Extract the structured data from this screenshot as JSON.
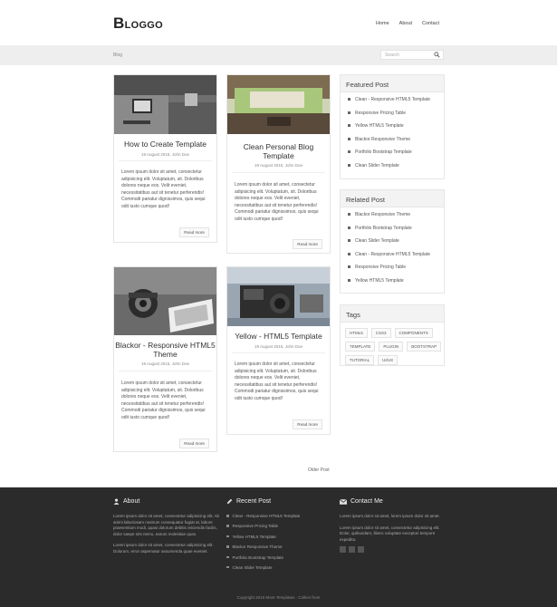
{
  "header": {
    "logo_big": "B",
    "logo_rest": "LOGGO",
    "nav": [
      "Home",
      "About",
      "Contact"
    ]
  },
  "subbar": {
    "breadcrumb": "Blog",
    "search_placeholder": "Search"
  },
  "posts": [
    {
      "title": "How to Create Template",
      "meta": "19 August 2015, John Doe",
      "excerpt": "Lorem ipsum dolor sit amet, consectetur adipisicing elit. Voluptatum, sit. Doloribus dolores neque eos. Velit eveniet, necessitatibus aut sit tenetur perferendis! Commodi pariatur dignissimos, quis sequi odit iusto cumque quod!",
      "more": "Read more"
    },
    {
      "title": "Clean Personal Blog Template",
      "meta": "19 August 2015, John Doe",
      "excerpt": "Lorem ipsum dolor sit amet, consectetur adipisicing elit. Voluptatum, sit. Doloribus dolores neque eos. Velit eveniet, necessitatibus aut sit tenetur perferendis! Commodi pariatur dignissimos, quis sequi odit iusto cumque quod!",
      "more": "Read more"
    },
    {
      "title": "Blackor - Responsive HTML5 Theme",
      "meta": "19 August 2015, John Doe",
      "excerpt": "Lorem ipsum dolor sit amet, consectetur adipisicing elit. Voluptatum, sit. Doloribus dolores neque eos. Velit eveniet, necessitatibus aut sit tenetur perferendis! Commodi pariatur dignissimos, quis sequi odit iusto cumque quod!",
      "more": "Read more"
    },
    {
      "title": "Yellow - HTML5 Template",
      "meta": "19 August 2015, John Doe",
      "excerpt": "Lorem ipsum dolor sit amet, consectetur adipisicing elit. Voluptatum, sit. Doloribus dolores neque eos. Velit eveniet, necessitatibus aut sit tenetur perferendis! Commodi pariatur dignissimos, quis sequi odit iusto cumque quod!",
      "more": "Read more"
    }
  ],
  "featured": {
    "title": "Featured Post",
    "items": [
      "Clean - Responsive HTML5 Template",
      "Responsive Pricing Table",
      "Yellow HTML5 Template",
      "Blackor Responsive Theme",
      "Portfolio Bootstrap Template",
      "Clean Slider Template"
    ]
  },
  "related": {
    "title": "Related Post",
    "items": [
      "Blackor Responsive Theme",
      "Portfolio Bootstrap Template",
      "Clean Slider Template",
      "Clean - Responsive HTML5 Template",
      "Responsive Pricing Table",
      "Yellow HTML5 Template"
    ]
  },
  "tags": {
    "title": "Tags",
    "items": [
      "HTML5",
      "CSS3",
      "COMPONENTS",
      "TEMPLATE",
      "PLUGIN",
      "BOOTSTRAP",
      "TUTORIAL",
      "UI/UX"
    ]
  },
  "older": "Older Post",
  "footer": {
    "about_title": "About",
    "about_text_1": "Lorem ipsum dolor sit amet, consectetur adipisicing elit. Ab animi laboriosam nostrum consequatur fugiat at, labore praesentium modi, quasi dolorum debitis reiciendis facilis, dolor saepe sint nemo, earum molestiae quas.",
    "about_text_2": "Lorem ipsum dolor sit amet, consectetur adipisicing elit. Dolorum, error aspernatur assumenda quae eveniet.",
    "recent_title": "Recent Post",
    "recent_items": [
      "Clean - Responsive HTML5 Template",
      "Responsive Pricing Table",
      "Yellow HTML5 Template",
      "Blackor Responsive Theme",
      "Portfolio Bootstrap Template",
      "Clean Slider Template"
    ],
    "contact_title": "Contact Me",
    "contact_text_1": "Lorem ipsum dolor sit amet, lorem ipsum dolor sit amet.",
    "contact_text_2": "Lorem ipsum dolor sit amet, consectetur adipisicing elit. Dolor, quibusdam, libero voluptate excepturi tempore expedita.",
    "copyright": "Copyright 2015 More Templates · Collect from"
  },
  "colors": {
    "footer_bg": "#2b2b2b",
    "subbar_bg": "#eeeeee",
    "widget_head_bg": "#f3f3f3"
  }
}
